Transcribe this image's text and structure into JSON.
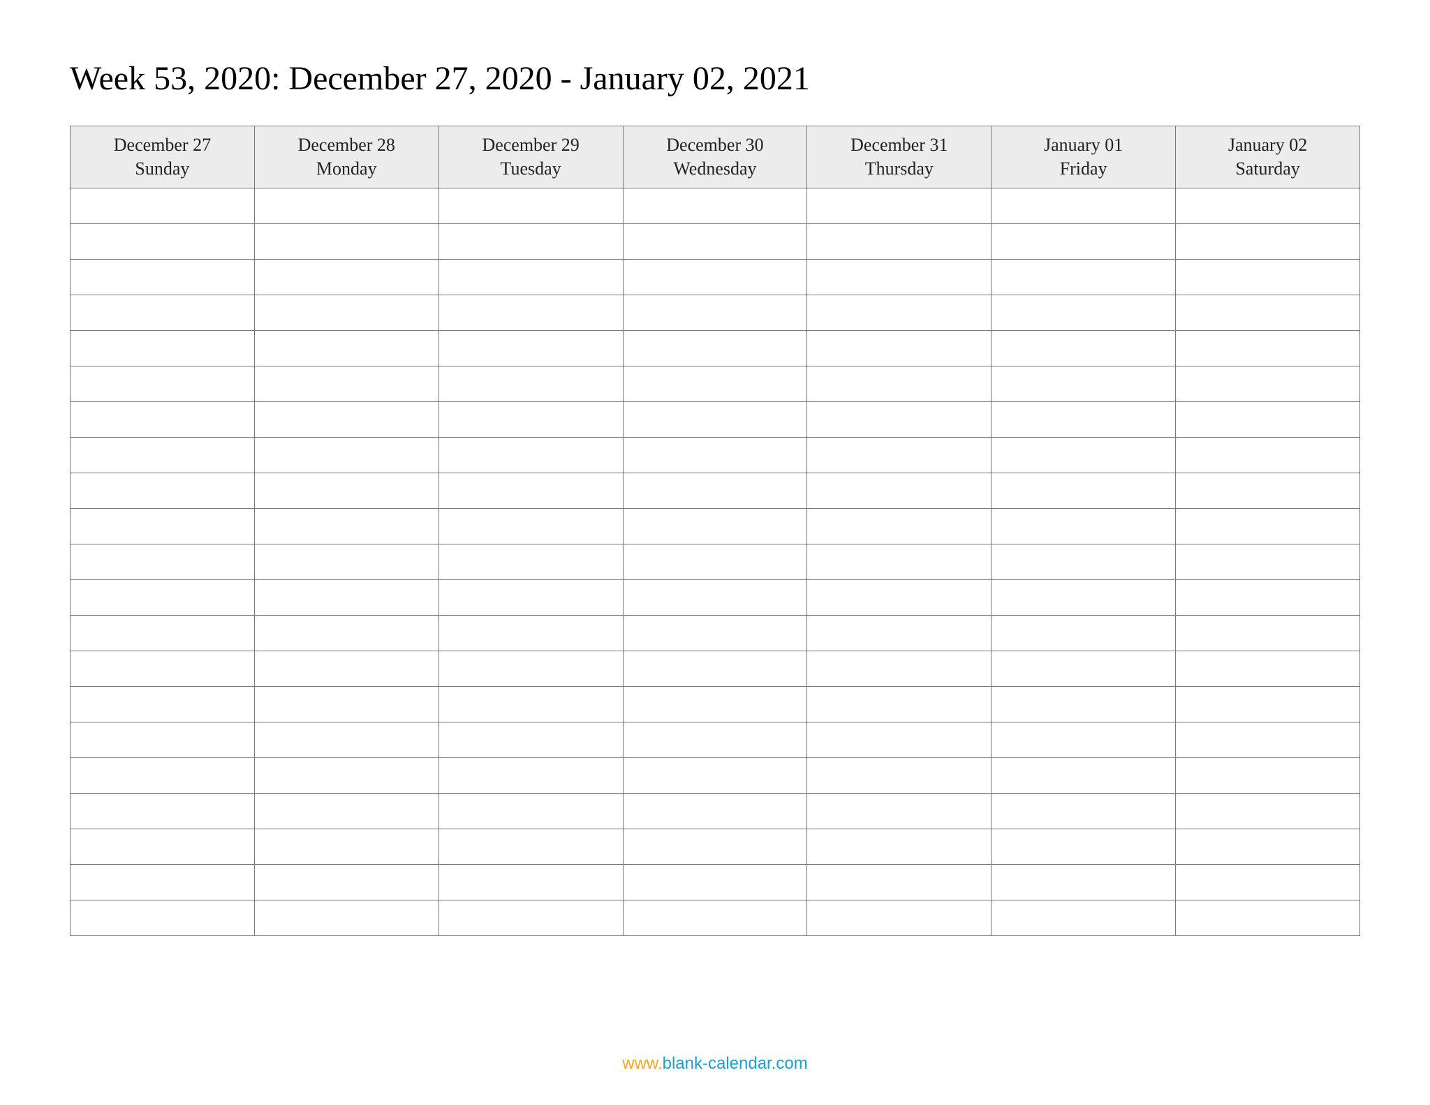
{
  "title": "Week 53, 2020: December 27, 2020 - January 02, 2021",
  "columns": [
    {
      "date": "December 27",
      "day": "Sunday"
    },
    {
      "date": "December 28",
      "day": "Monday"
    },
    {
      "date": "December 29",
      "day": "Tuesday"
    },
    {
      "date": "December 30",
      "day": "Wednesday"
    },
    {
      "date": "December 31",
      "day": "Thursday"
    },
    {
      "date": "January 01",
      "day": "Friday"
    },
    {
      "date": "January 02",
      "day": "Saturday"
    }
  ],
  "row_count": 21,
  "footer": {
    "www": "www.",
    "domain": "blank-calendar.com"
  }
}
